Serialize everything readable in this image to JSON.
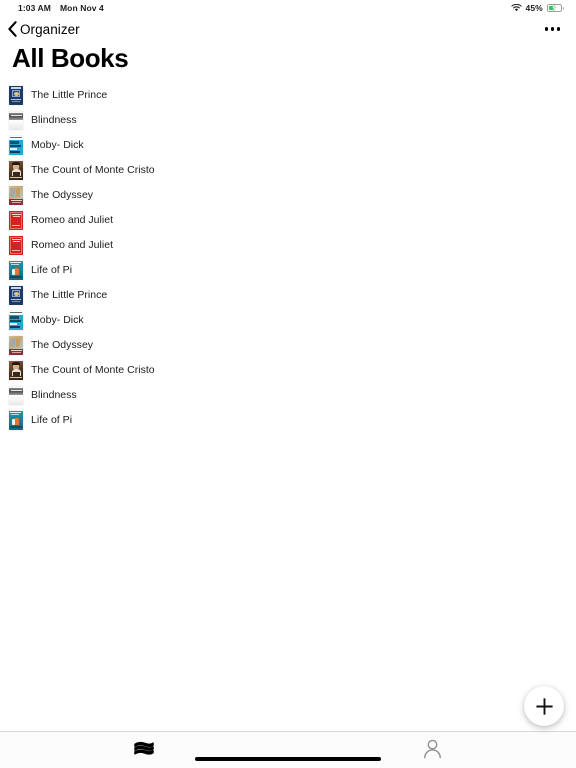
{
  "status_bar": {
    "time": "1:03 AM",
    "date": "Mon Nov 4",
    "wifi_icon": "wifi-icon",
    "battery_percent": "45%",
    "battery_level": 45,
    "battery_charging": true,
    "battery_color": "#34c759"
  },
  "nav_bar": {
    "back_icon": "chevron-left-icon",
    "back_label": "Organizer",
    "more_icon": "ellipsis-icon"
  },
  "header": {
    "title": "All Books"
  },
  "books": [
    {
      "title": "The Little Prince",
      "cover": "cv-prince",
      "cover_name": "book-cover-the-little-prince"
    },
    {
      "title": "Blindness",
      "cover": "cv-blindness",
      "cover_name": "book-cover-blindness"
    },
    {
      "title": "Moby- Dick",
      "cover": "cv-moby",
      "cover_name": "book-cover-moby-dick"
    },
    {
      "title": "The Count of Monte Cristo",
      "cover": "cv-count",
      "cover_name": "book-cover-the-count-of-monte-cristo"
    },
    {
      "title": "The Odyssey",
      "cover": "cv-odyssey",
      "cover_name": "book-cover-the-odyssey"
    },
    {
      "title": "Romeo and Juliet",
      "cover": "cv-romeo",
      "cover_name": "book-cover-romeo-and-juliet"
    },
    {
      "title": "Romeo and Juliet",
      "cover": "cv-romeo",
      "cover_name": "book-cover-romeo-and-juliet"
    },
    {
      "title": "Life of Pi",
      "cover": "cv-pi",
      "cover_name": "book-cover-life-of-pi"
    },
    {
      "title": "The Little Prince",
      "cover": "cv-prince",
      "cover_name": "book-cover-the-little-prince"
    },
    {
      "title": "Moby- Dick",
      "cover": "cv-moby",
      "cover_name": "book-cover-moby-dick"
    },
    {
      "title": "The Odyssey",
      "cover": "cv-odyssey",
      "cover_name": "book-cover-the-odyssey"
    },
    {
      "title": "The Count of Monte Cristo",
      "cover": "cv-count",
      "cover_name": "book-cover-the-count-of-monte-cristo"
    },
    {
      "title": "Blindness",
      "cover": "cv-blindness",
      "cover_name": "book-cover-blindness"
    },
    {
      "title": "Life of Pi",
      "cover": "cv-pi",
      "cover_name": "book-cover-life-of-pi"
    }
  ],
  "fab": {
    "icon": "plus-icon",
    "label": "+"
  },
  "tab_bar": {
    "items": [
      {
        "icon": "books-stack-icon",
        "name": "tab-library",
        "active": true,
        "color": "#000000"
      },
      {
        "icon": "person-icon",
        "name": "tab-account",
        "active": false,
        "color": "#8e8e93"
      }
    ]
  },
  "home_indicator": {
    "name": "home-indicator"
  }
}
